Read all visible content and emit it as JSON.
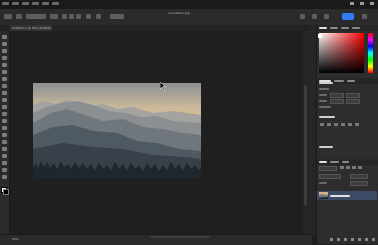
{
  "window": {
    "document_tab": "Untitled-1 @ 50% (RGB/8)",
    "document_title": "mountains.jpg"
  },
  "status": {
    "zoom": "50%"
  },
  "toolbar": {
    "tools": [
      "move-icon",
      "marquee-icon",
      "lasso-icon",
      "magic-wand-icon",
      "crop-icon",
      "eyedropper-icon",
      "healing-brush-icon",
      "brush-icon",
      "clone-stamp-icon",
      "history-brush-icon",
      "eraser-icon",
      "gradient-icon",
      "blur-icon",
      "dodge-icon",
      "pen-icon",
      "type-icon",
      "path-selection-icon",
      "rectangle-icon",
      "hand-icon",
      "zoom-icon",
      "edit-toolbar-icon"
    ]
  },
  "colors": {
    "accent": "#2f7cf6",
    "foreground": "#ffffff",
    "background": "#000000",
    "picker_hue": "#ff0000",
    "selected_layer": "#3d4a66"
  },
  "panels": {
    "top_tabs": 5,
    "layer_count": 1
  }
}
